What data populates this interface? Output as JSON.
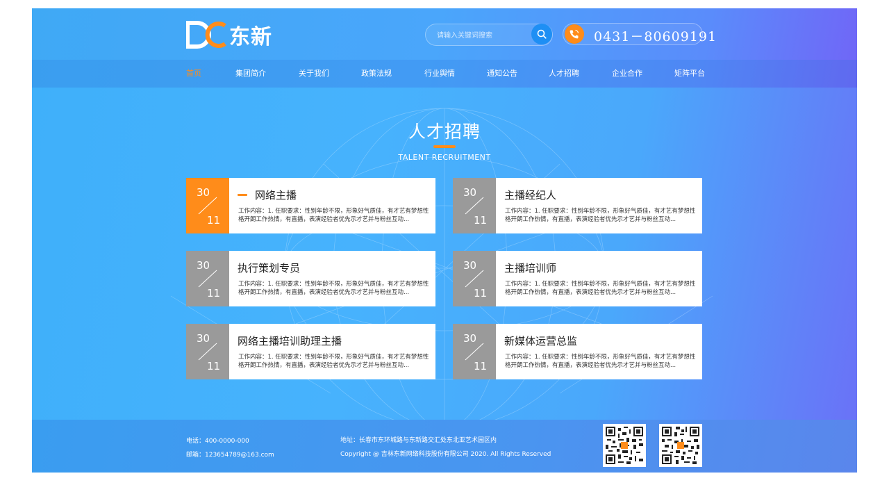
{
  "header": {
    "logo_text": "东新",
    "search_placeholder": "请输入关键词搜索",
    "phone": "0431－80609191"
  },
  "nav": {
    "items": [
      {
        "label": "首页",
        "active": true
      },
      {
        "label": "集团简介"
      },
      {
        "label": "关于我们"
      },
      {
        "label": "政策法规"
      },
      {
        "label": "行业舆情"
      },
      {
        "label": "通知公告"
      },
      {
        "label": "人才招聘"
      },
      {
        "label": "企业合作"
      },
      {
        "label": "矩阵平台"
      }
    ]
  },
  "section": {
    "title": "人才招聘",
    "subtitle": "TALENT RECRUITMENT"
  },
  "jobs": [
    {
      "day": "30",
      "month": "11",
      "title": "网络主播",
      "desc": "工作内容：1. 任职要求：性别年龄不限，形象好气质佳，有才艺有梦想性格开朗工作热情，有直播，表演经验者优先示才艺并与粉丝互动..."
    },
    {
      "day": "30",
      "month": "11",
      "title": "主播经纪人",
      "desc": "工作内容：1. 任职要求：性别年龄不限，形象好气质佳，有才艺有梦想性格开朗工作热情，有直播，表演经验者优先示才艺并与粉丝互动..."
    },
    {
      "day": "30",
      "month": "11",
      "title": "执行策划专员",
      "desc": "工作内容：1. 任职要求：性别年龄不限，形象好气质佳，有才艺有梦想性格开朗工作热情，有直播，表演经验者优先示才艺并与粉丝互动..."
    },
    {
      "day": "30",
      "month": "11",
      "title": "主播培训师",
      "desc": "工作内容：1. 任职要求：性别年龄不限，形象好气质佳，有才艺有梦想性格开朗工作热情，有直播，表演经验者优先示才艺并与粉丝互动..."
    },
    {
      "day": "30",
      "month": "11",
      "title": "网络主播培训助理主播",
      "desc": "工作内容：1. 任职要求：性别年龄不限，形象好气质佳，有才艺有梦想性格开朗工作热情，有直播，表演经验者优先示才艺并与粉丝互动..."
    },
    {
      "day": "30",
      "month": "11",
      "title": "新媒体运营总监",
      "desc": "工作内容：1. 任职要求：性别年龄不限，形象好气质佳，有才艺有梦想性格开朗工作热情，有直播，表演经验者优先示才艺并与粉丝互动..."
    }
  ],
  "footer": {
    "tel": "电话：400-0000-000",
    "email": "邮箱：123654789@163.com",
    "address": "地址：长春市东环城路与东新路交汇处东北亚艺术园区内",
    "copyright": "Copyright @ 吉林东新网络科技股份有限公司 2020. All Rights Reserved"
  },
  "colors": {
    "accent": "#ff8c1a",
    "search_button": "#1e8ff4",
    "date_gray": "#9a9a9a"
  },
  "icons": [
    "logo-mark-icon",
    "search-icon",
    "phone-icon",
    "qr-code-icon"
  ]
}
